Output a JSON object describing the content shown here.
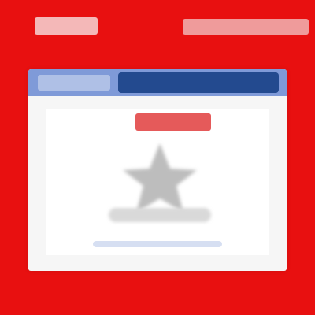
{
  "colors": {
    "frame": "#e81010",
    "titlebar": "#7f9ad8",
    "title_accent": "#234a8f",
    "panel_bg": "#f6f6f6",
    "badge": "#e55a5a",
    "graphic": "#bdbdbd"
  },
  "icons": {
    "graphic": "star-icon"
  },
  "text": {
    "badge": ""
  }
}
